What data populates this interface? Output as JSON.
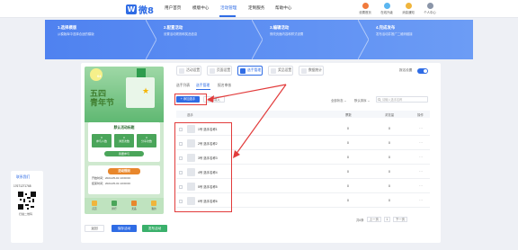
{
  "brand": {
    "logo_letter": "W",
    "logo_text": "微8",
    "color": "#2f6ce5"
  },
  "nav": {
    "items": [
      "用户首页",
      "模版中心",
      "活动管理",
      "定制服务",
      "帮助中心"
    ],
    "active_index": 2
  },
  "tools": [
    {
      "label": "设置首页",
      "color": "#f07a3c"
    },
    {
      "label": "在线升级",
      "color": "#5bb6f0"
    },
    {
      "label": "消息通知",
      "color": "#f0b53c"
    },
    {
      "label": "个人中心",
      "color": "#8a95a8"
    }
  ],
  "steps": [
    {
      "title": "1.选择模版",
      "desc": "从模版库中选择合适的模版"
    },
    {
      "title": "2.配置活动",
      "desc": "设置活动规则和奖品信息"
    },
    {
      "title": "3.编辑活动",
      "desc": "修改页面内容和样式设置"
    },
    {
      "title": "4.完成发布",
      "desc": "发布活动并推广二维码链接"
    }
  ],
  "contact": {
    "title": "联系我们",
    "phone": "17671271768",
    "qr_caption": "扫描二维码"
  },
  "poster": {
    "title_line1": "五四",
    "title_line2": "青年节",
    "badge": "04"
  },
  "phone_panel1": {
    "heading": "默认活动标题",
    "boxes": [
      "0\n参与人数",
      "0\n浏览次数",
      "0\n分享次数"
    ],
    "button": "我要参与"
  },
  "phone_panel2": {
    "button": "活动规则",
    "line1": "开始时间：2024-05-01 10:00:00",
    "line2": "结束时间：2024-05-31 10:00:00"
  },
  "phone_nav": [
    {
      "label": "首页",
      "color": "#f0b53c"
    },
    {
      "label": "排行",
      "color": "#4aa55a"
    },
    {
      "label": "奖品",
      "color": "#e8872c"
    },
    {
      "label": "我的",
      "color": "#f0b53c"
    }
  ],
  "top_tabs": [
    "活动设置",
    "页面设置",
    "选手管理",
    "奖品设置",
    "数据统计"
  ],
  "top_tabs_active": 2,
  "toggle_label": "报名设置",
  "sub_tabs": [
    "选手列表",
    "选手管理",
    "报名审核"
  ],
  "sub_tabs_active": 1,
  "toolbar": {
    "add": "+ 添加选手",
    "batch": "批量导入",
    "filter1": "全部状态 ⌄",
    "filter2": "默认排序 ⌄",
    "search_placeholder": "请输入选手名称"
  },
  "table": {
    "headers": [
      "选手",
      "票数",
      "浏览量",
      "操作"
    ],
    "rows": [
      {
        "name": "1号  选手名称1",
        "votes": "0",
        "views": "0",
        "op": "···"
      },
      {
        "name": "2号  选手名称2",
        "votes": "0",
        "views": "0",
        "op": "···"
      },
      {
        "name": "3号  选手名称3",
        "votes": "0",
        "views": "0",
        "op": "···"
      },
      {
        "name": "4号  选手名称4",
        "votes": "0",
        "views": "0",
        "op": "···"
      },
      {
        "name": "5号  选手名称5",
        "votes": "0",
        "views": "0",
        "op": "···"
      },
      {
        "name": "6号  选手名称6",
        "votes": "0",
        "views": "0",
        "op": "···"
      }
    ]
  },
  "pager": {
    "total": "共6条",
    "prev": "上一页",
    "current": "1",
    "next": "下一页"
  },
  "bottom_buttons": {
    "back": "返回",
    "save": "保存活动",
    "publish": "发布活动"
  }
}
